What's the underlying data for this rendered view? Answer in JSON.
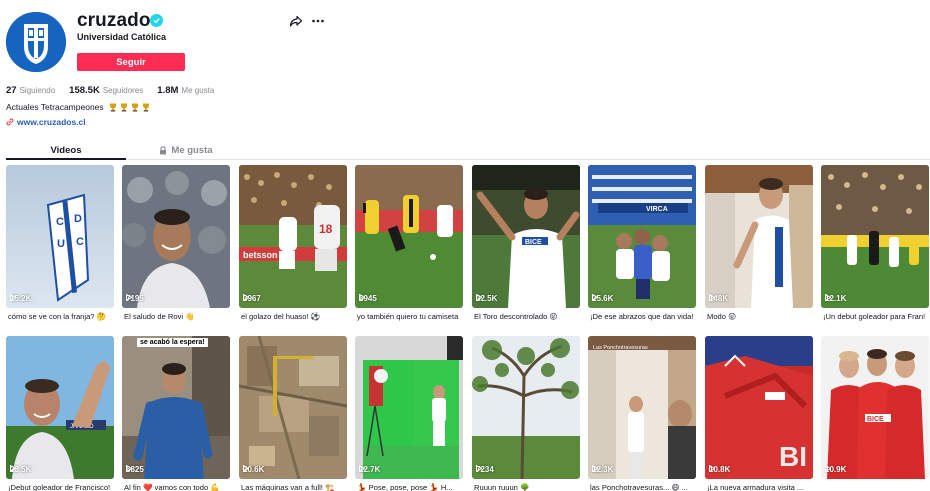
{
  "profile": {
    "username": "cruzados",
    "subtitle": "Universidad Católica",
    "follow_label": "Seguir",
    "bio": "Actuales Tetracampeones",
    "link": "www.cruzados.cl"
  },
  "stats": [
    {
      "value": "27",
      "label": "Siguiendo"
    },
    {
      "value": "158.5K",
      "label": "Seguidores"
    },
    {
      "value": "1.8M",
      "label": "Me gusta"
    }
  ],
  "tabs": {
    "videos": "Videos",
    "likes": "Me gusta"
  },
  "icons": [
    "verified-icon",
    "share-icon",
    "more-icon",
    "trophy-icon",
    "link-icon",
    "lock-icon",
    "play-icon"
  ],
  "colors": {
    "accent": "#fe2c55",
    "link": "#2b5db9",
    "verified": "#20d5ec"
  },
  "videos": [
    {
      "views": "15.2K",
      "caption": "cómo se ve con la franja? 🤔"
    },
    {
      "views": "7195",
      "caption": "El saludo de Rovi 👋"
    },
    {
      "views": "3967",
      "caption": "el golazo del huaso! ⚽"
    },
    {
      "views": "6945",
      "caption": "yo también quiero tu camiseta"
    },
    {
      "views": "32.5K",
      "caption": "El Toro descontrolado 😜"
    },
    {
      "views": "25.6K",
      "caption": "¡De ese abrazos que dan vida!"
    },
    {
      "views": "148K",
      "caption": "Modo 😜"
    },
    {
      "views": "12.1K",
      "caption": "¡Un debut goleador para Fran!"
    },
    {
      "views": "23.5K",
      "caption": "¡Debut goleador de Francisco!"
    },
    {
      "views": "6825",
      "caption": "Al fin ❤️ vamos con todo 💪",
      "overlay": "se acabó la espera!"
    },
    {
      "views": "20.6K",
      "caption": "Las máquinas van a full! 🏗️"
    },
    {
      "views": "12.7K",
      "caption": "💃 Pose, pose, pose 💃 H..."
    },
    {
      "views": "7234",
      "caption": "Ruuun ruuun 🌳"
    },
    {
      "views": "12.3K",
      "caption": "las Ponchotravesuras... 😄 ...",
      "overlay_small": "Las Ponchotravesuras"
    },
    {
      "views": "10.8K",
      "caption": "¡La nueva armadura visita ..."
    },
    {
      "views": "10.9K",
      "caption": ""
    }
  ]
}
